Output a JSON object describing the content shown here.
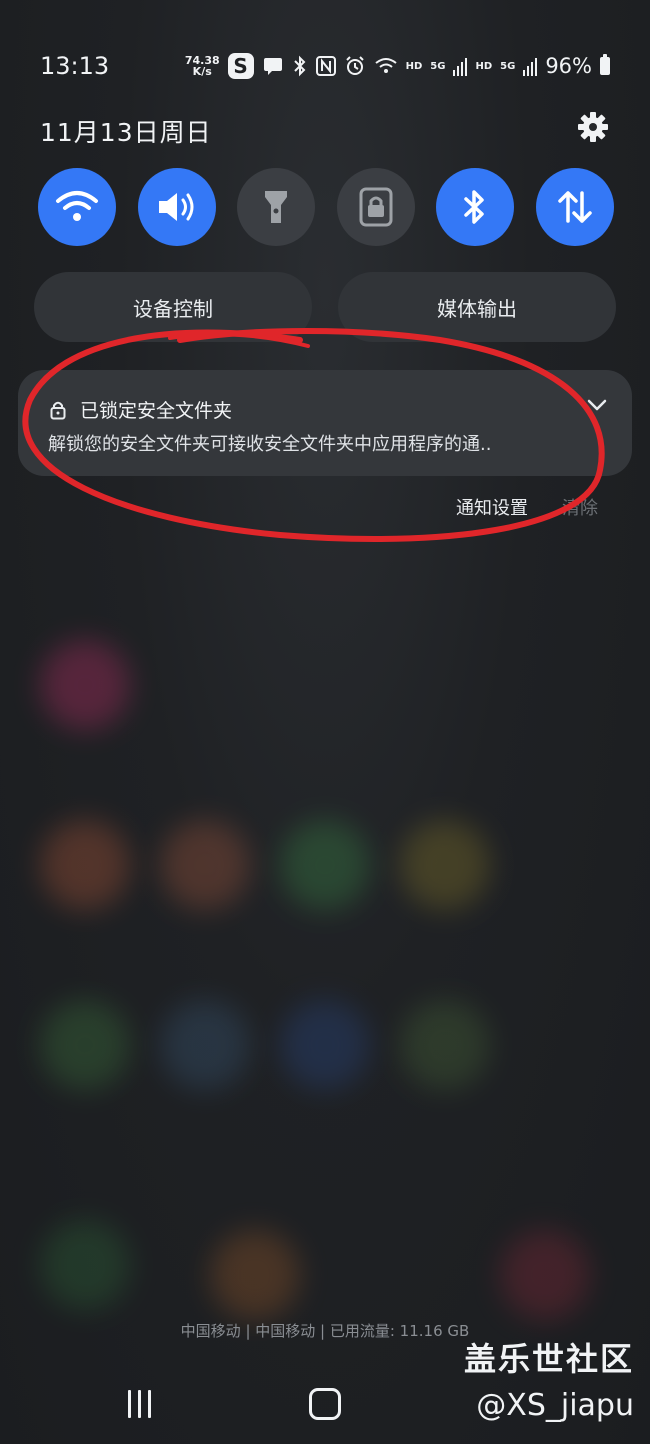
{
  "status_bar": {
    "time": "13:13",
    "net_speed_value": "74.38",
    "net_speed_unit": "K/s",
    "sim1_label": "HD",
    "sim1_network": "5G",
    "sim2_label": "HD",
    "sim2_network": "5G",
    "battery_percent": "96%"
  },
  "header": {
    "date": "11月13日周日"
  },
  "quick_toggles": [
    {
      "name": "wifi",
      "state": "on",
      "icon": "wifi-icon"
    },
    {
      "name": "sound",
      "state": "on",
      "icon": "speaker-icon"
    },
    {
      "name": "flashlight",
      "state": "off",
      "icon": "flashlight-icon"
    },
    {
      "name": "screen-rotation-lock",
      "state": "off",
      "icon": "lock-icon"
    },
    {
      "name": "bluetooth",
      "state": "on",
      "icon": "bluetooth-icon"
    },
    {
      "name": "mobile-data",
      "state": "on",
      "icon": "data-arrows-icon"
    }
  ],
  "pills": {
    "device_control": "设备控制",
    "media_output": "媒体输出"
  },
  "notification": {
    "title": "已锁定安全文件夹",
    "body": "解锁您的安全文件夹可接收安全文件夹中应用程序的通.."
  },
  "notification_actions": {
    "settings": "通知设置",
    "clear": "清除"
  },
  "carrier_info": "中国移动 | 中国移动 | 已用流量: 11.16 GB",
  "watermark": {
    "site": "盖乐世社区",
    "user": "@XS_jiapu"
  },
  "colors": {
    "accent_blue": "#3478f6",
    "toggle_off": "#3b3e43",
    "annotation_red": "#e0262a"
  }
}
